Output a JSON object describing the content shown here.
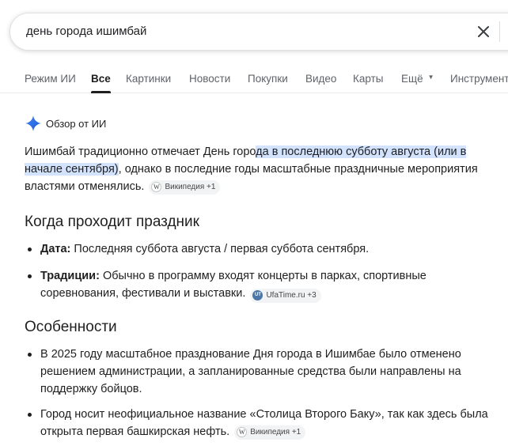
{
  "search": {
    "query": "день города ишимбай",
    "clear_icon": "close-icon"
  },
  "tabs": [
    {
      "label": "Режим ИИ",
      "active": false
    },
    {
      "label": "Все",
      "active": true
    },
    {
      "label": "Картинки",
      "active": false
    },
    {
      "label": "Новости",
      "active": false
    },
    {
      "label": "Покупки",
      "active": false
    },
    {
      "label": "Видео",
      "active": false
    },
    {
      "label": "Карты",
      "active": false
    },
    {
      "label": "Ещё",
      "active": false
    },
    {
      "label": "Инструменты",
      "active": false
    }
  ],
  "ai_overview": {
    "header_label": "Обзор от ИИ",
    "intro": {
      "before": "Ишимбай традиционно отмечает День горо",
      "highlight": "да в последнюю субботу августа (или в начале сентября)",
      "after": ", однако в последние годы масштабные праздничные мероприятия властями отменялись.",
      "source_chip": "Википедия +1"
    },
    "section1": {
      "title": "Когда проходит праздник",
      "items": [
        {
          "bold": "Дата:",
          "text": " Последняя суббота августа / первая суббота сентября."
        },
        {
          "bold": "Традиции:",
          "text": " Обычно в программу входят концерты в парках, спортивные соревнования, фестивали и выставки.",
          "source_chip": "UfaTime.ru +3",
          "source_badge": "UT"
        }
      ]
    },
    "section2": {
      "title": "Особенности",
      "items": [
        {
          "text": "В 2025 году масштабное празднование Дня города в Ишимбае было отменено решением администрации, а запланированные средства были направлены на поддержку бойцов."
        },
        {
          "text": "Город носит неофициальное название «Столица Второго Баку», так как здесь была открыта первая башкирская нефть.",
          "source_chip": "Википедия +1"
        }
      ]
    }
  },
  "colors": {
    "highlight": "#d3e3fd",
    "chip_bg": "#f1f3f4",
    "ai_star": "#1a73e8"
  }
}
